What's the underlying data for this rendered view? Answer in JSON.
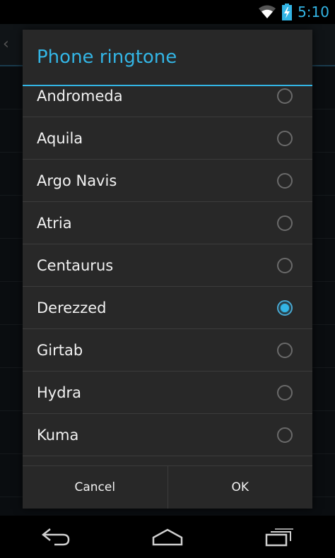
{
  "status_bar": {
    "time": "5:10",
    "icons": [
      "wifi-icon",
      "battery-charging-icon"
    ]
  },
  "dialog": {
    "title": "Phone ringtone",
    "items": [
      {
        "label": "Andromeda",
        "selected": false
      },
      {
        "label": "Aquila",
        "selected": false
      },
      {
        "label": "Argo Navis",
        "selected": false
      },
      {
        "label": "Atria",
        "selected": false
      },
      {
        "label": "Centaurus",
        "selected": false
      },
      {
        "label": "Derezzed",
        "selected": true
      },
      {
        "label": "Girtab",
        "selected": false
      },
      {
        "label": "Hydra",
        "selected": false
      },
      {
        "label": "Kuma",
        "selected": false
      }
    ],
    "cancel_label": "Cancel",
    "ok_label": "OK"
  },
  "nav_bar": {
    "icons": [
      "back-icon",
      "home-icon",
      "recent-apps-icon"
    ]
  },
  "colors": {
    "accent": "#33b5e5",
    "dialog_bg": "#282828",
    "divider": "#3c3c3c"
  }
}
